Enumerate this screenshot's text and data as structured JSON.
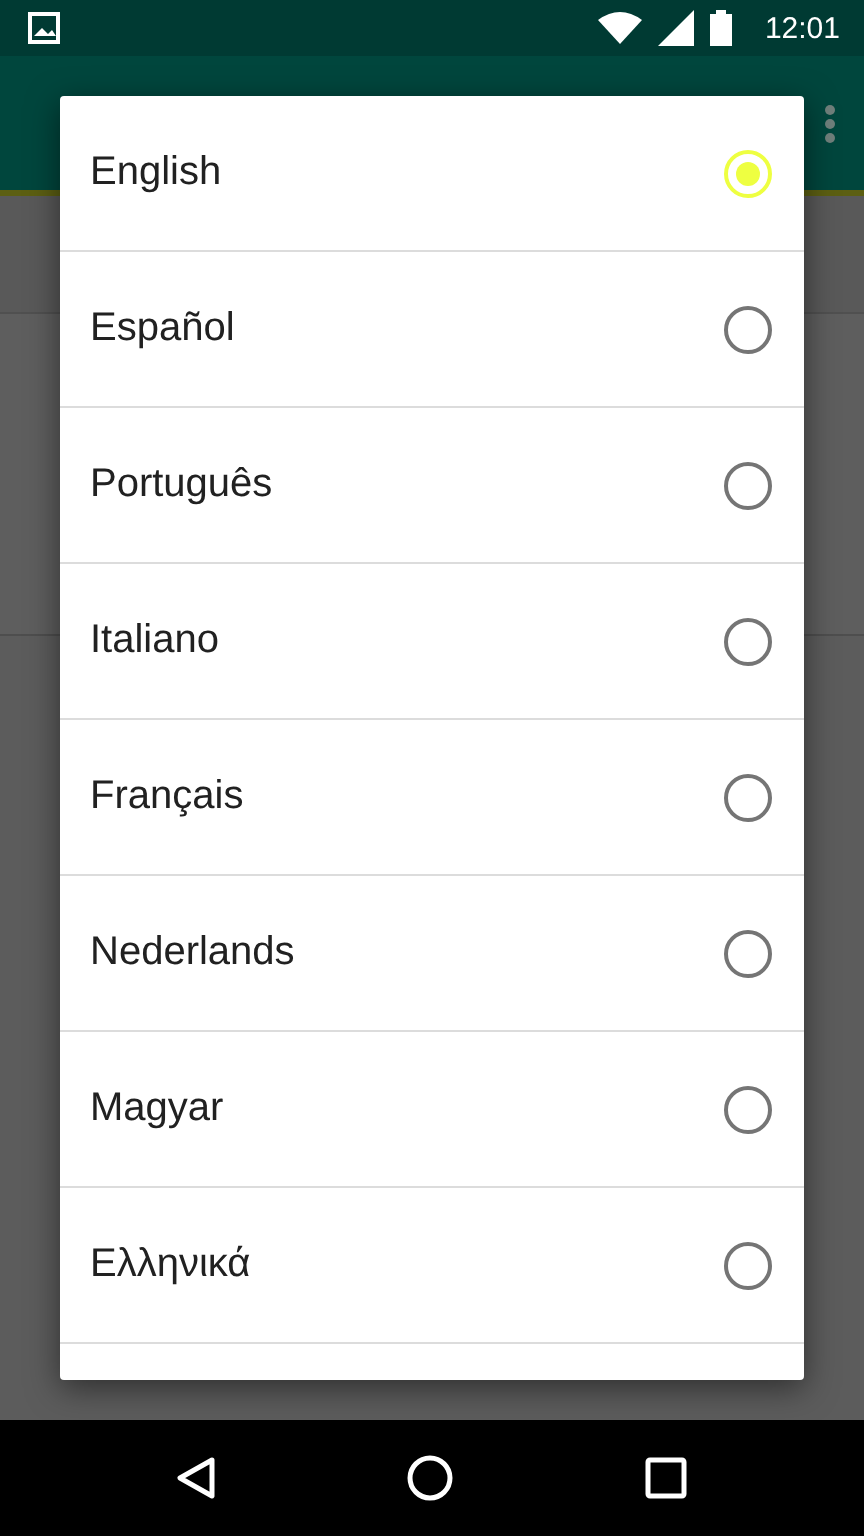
{
  "status_bar": {
    "time": "12:01"
  },
  "language_dialog": {
    "options": [
      {
        "label": "English",
        "selected": true
      },
      {
        "label": "Español",
        "selected": false
      },
      {
        "label": "Português",
        "selected": false
      },
      {
        "label": "Italiano",
        "selected": false
      },
      {
        "label": "Français",
        "selected": false
      },
      {
        "label": "Nederlands",
        "selected": false
      },
      {
        "label": "Magyar",
        "selected": false
      },
      {
        "label": "Ελληνικά",
        "selected": false
      }
    ]
  }
}
